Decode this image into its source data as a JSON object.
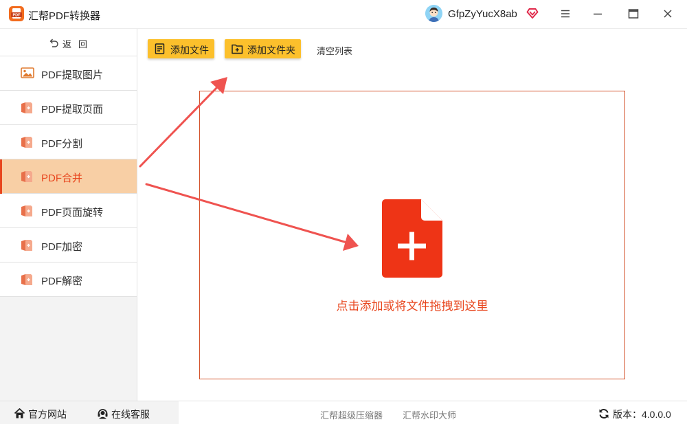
{
  "window": {
    "title": "汇帮PDF转换器",
    "username": "GfpZyYucX8ab",
    "icons": {
      "logo": "pdf-logo-icon",
      "avatar": "user-avatar",
      "vip": "vip-diamond-icon",
      "menu": "hamburger-menu-icon",
      "minimize": "minimize-icon",
      "maximize": "maximize-icon",
      "close": "close-icon"
    }
  },
  "sidebar": {
    "back_label": "返回",
    "items": [
      {
        "label": "PDF提取图片",
        "icon": "image-icon",
        "active": false
      },
      {
        "label": "PDF提取页面",
        "icon": "pdf-page-icon",
        "active": false
      },
      {
        "label": "PDF分割",
        "icon": "pdf-page-icon",
        "active": false
      },
      {
        "label": "PDF合并",
        "icon": "pdf-page-icon",
        "active": true
      },
      {
        "label": "PDF页面旋转",
        "icon": "pdf-page-icon",
        "active": false
      },
      {
        "label": "PDF加密",
        "icon": "pdf-page-icon",
        "active": false
      },
      {
        "label": "PDF解密",
        "icon": "pdf-page-icon",
        "active": false
      }
    ]
  },
  "toolbar": {
    "add_file": "添加文件",
    "add_folder": "添加文件夹",
    "clear_list": "清空列表"
  },
  "dropzone": {
    "text": "点击添加或将文件拖拽到这里",
    "icon": "file-plus-icon"
  },
  "footer": {
    "official_site": "官方网站",
    "online_service": "在线客服",
    "link_compress": "汇帮超级压缩器",
    "link_watermark": "汇帮水印大师",
    "version": "版本：4.0.0.0"
  },
  "colors": {
    "accent": "#e8461e",
    "button": "#fcc02c",
    "active_bg": "#f8cfa5",
    "arrow": "#ef5350"
  }
}
